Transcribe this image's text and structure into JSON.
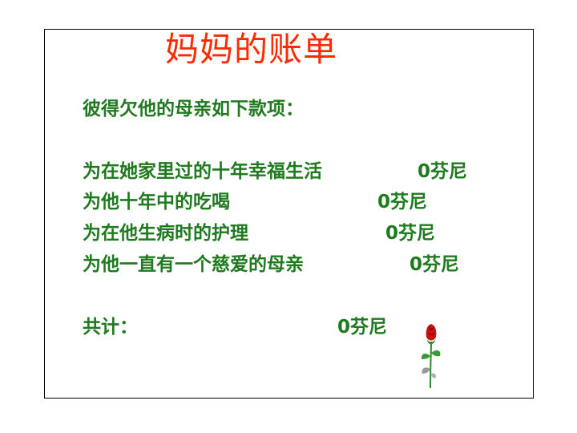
{
  "title": "妈妈的账单",
  "intro": "彼得欠他的母亲如下款项：",
  "items": [
    {
      "label": "为在她家里过的十年幸福生活",
      "amount": "0芬尼"
    },
    {
      "label": "为他十年中的吃喝",
      "amount": "0芬尼"
    },
    {
      "label": "为在他生病时的护理",
      "amount": "0芬尼"
    },
    {
      "label": "为他一直有一个慈爱的母亲",
      "amount": "0芬尼"
    }
  ],
  "total": {
    "label": "共计：",
    "amount": "0芬尼"
  },
  "colors": {
    "title": "#ff2a00",
    "text": "#1f7a1f",
    "rose": "#cc1111"
  }
}
